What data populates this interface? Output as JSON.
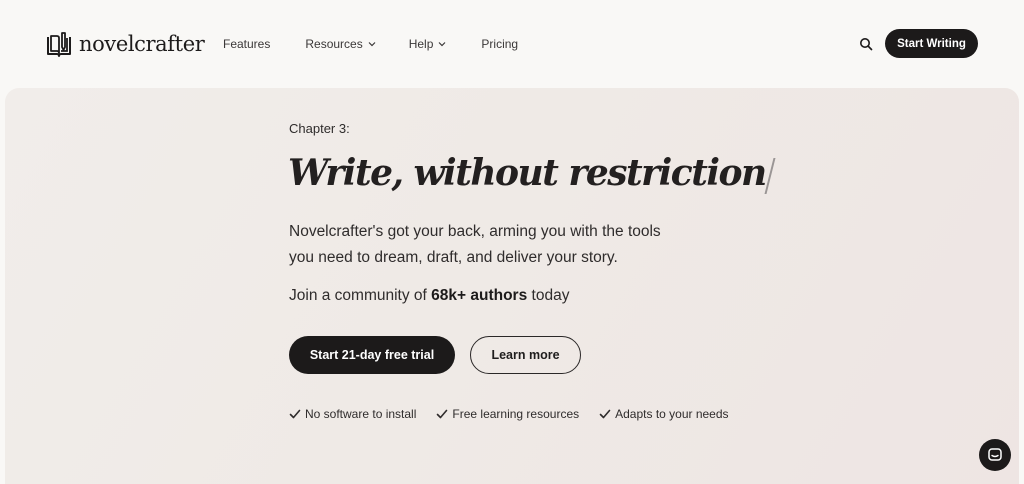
{
  "brand": {
    "name": "novelcrafter",
    "logo_icon": "book-pen-icon"
  },
  "nav": {
    "items": [
      {
        "label": "Features",
        "has_dropdown": false
      },
      {
        "label": "Resources",
        "has_dropdown": true
      },
      {
        "label": "Help",
        "has_dropdown": true
      },
      {
        "label": "Pricing",
        "has_dropdown": false
      }
    ],
    "search_icon": "search-icon",
    "cta_label": "Start Writing"
  },
  "hero": {
    "eyebrow": "Chapter 3:",
    "headline": "Write, without restriction",
    "description": "Novelcrafter's got your back, arming you with the tools you need to dream, draft, and deliver your story.",
    "community_prefix": "Join a community of ",
    "community_highlight": "68k+ authors",
    "community_suffix": " today",
    "primary_cta": "Start 21-day free trial",
    "secondary_cta": "Learn more",
    "features": [
      "No software to install",
      "Free learning resources",
      "Adapts to your needs"
    ]
  },
  "chat": {
    "icon": "chat-icon"
  },
  "colors": {
    "page_bg": "#f9f8f6",
    "hero_bg": "#efeae6",
    "primary": "#1c1a1a",
    "text": "#2f2c2c"
  }
}
